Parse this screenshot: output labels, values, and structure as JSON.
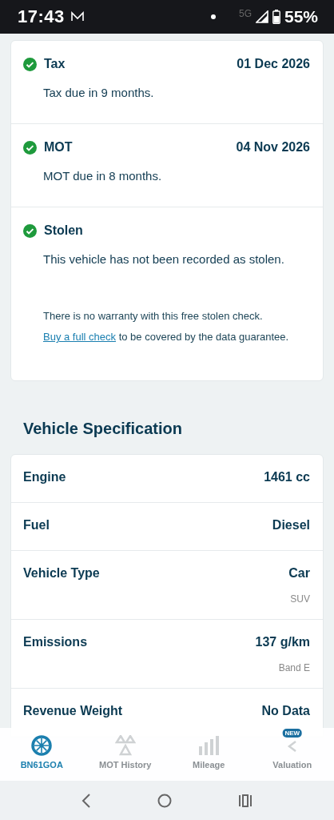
{
  "status_bar": {
    "time": "17:43",
    "network": "5G",
    "battery": "55%"
  },
  "checks": [
    {
      "title": "Tax",
      "passed": true,
      "date": "01 Dec 2026",
      "message": "Tax due in 9 months."
    },
    {
      "title": "MOT",
      "passed": true,
      "date": "04 Nov 2026",
      "message": "MOT due in 8 months."
    },
    {
      "title": "Stolen",
      "passed": true,
      "message": "This vehicle has not been recorded as stolen.",
      "note": {
        "before": "There is no warranty with this free stolen check.",
        "link": "Buy a full check",
        "after": "to be covered by the data guarantee."
      }
    }
  ],
  "specification": {
    "title": "Vehicle Specification",
    "rows": [
      {
        "label": "Engine",
        "value": "1461 cc"
      },
      {
        "label": "Fuel",
        "value": "Diesel"
      },
      {
        "label": "Vehicle Type",
        "value": "Car",
        "detail": "SUV"
      },
      {
        "label": "Emissions",
        "value": "137 g/km",
        "detail": "Band E"
      },
      {
        "label": "Revenue Weight",
        "value": "No Data"
      }
    ]
  },
  "bottom_nav": [
    {
      "kind": "wheel",
      "label": "BN61GOA",
      "selected": true
    },
    {
      "kind": "cones",
      "label": "MOT History",
      "selected": false
    },
    {
      "kind": "bars",
      "label": "Mileage",
      "selected": false
    },
    {
      "kind": "valuation",
      "label": "Valuation",
      "selected": false,
      "badge": "NEW"
    }
  ]
}
